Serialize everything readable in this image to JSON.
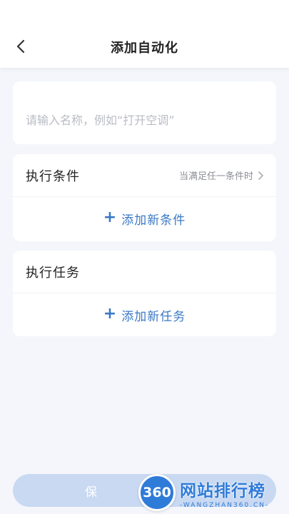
{
  "header": {
    "title": "添加自动化",
    "back_icon": "chevron-left-icon"
  },
  "name_field": {
    "placeholder": "请输入名称，例如“打开空调”",
    "value": ""
  },
  "conditions": {
    "title": "执行条件",
    "mode_label": "当满足任一条件时",
    "add_label": "添加新条件"
  },
  "tasks": {
    "title": "执行任务",
    "add_label": "添加新任务"
  },
  "footer": {
    "save_label": "保"
  },
  "watermark": {
    "logo_text": "360",
    "title": "网站排行榜",
    "subtitle": "-WANGZHAN360.CN-"
  },
  "colors": {
    "accent": "#3a78c4",
    "background": "#f4f6fb",
    "save_disabled": "#c9d9f2",
    "watermark": "#2f7bd8"
  }
}
